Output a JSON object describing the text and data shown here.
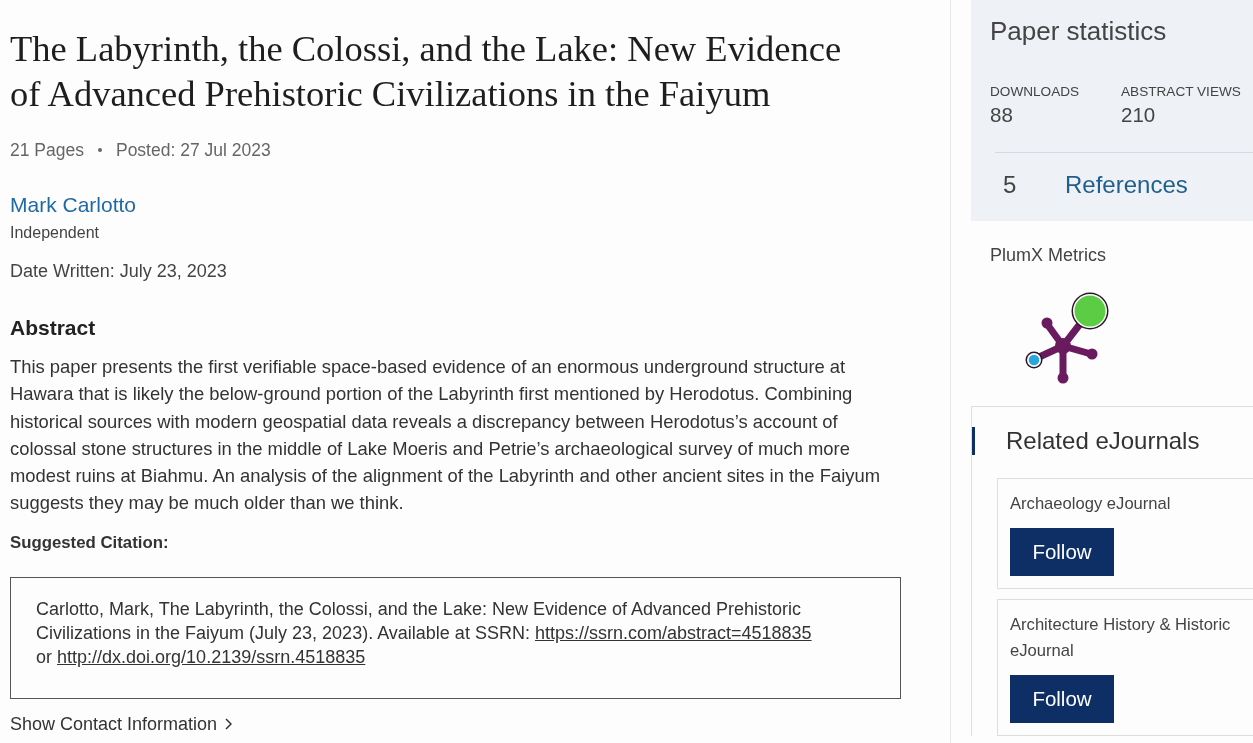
{
  "paper": {
    "title": "The Labyrinth, the Colossi, and the Lake: New Evidence of Advanced Prehistoric Civilizations in the Faiyum",
    "meta": [
      "21 Pages",
      "Posted: 27 Jul 2023"
    ],
    "authors": [
      {
        "name": "Mark Carlotto",
        "affiliation": "Independent"
      }
    ],
    "date_written": "Date Written: July 23, 2023",
    "abstract": {
      "heading": "Abstract",
      "text": "This paper presents the first verifiable space-based evidence of an enormous underground structure at Hawara that is likely the below-ground portion of the Labyrinth first mentioned by Herodotus. Combining historical sources with modern geospatial data reveals a discrepancy between Herodotus’s account of colossal stone structures in the middle of Lake Moeris and Petrie’s archaeological survey of much more modest ruins at Biahmu. An analysis of the alignment of the Labyrinth and other ancient sites in the Faiyum suggests they may be much older than we think."
    },
    "citation": {
      "heading": "Suggested Citation:",
      "parts": [
        {
          "kind": "text",
          "text": "Carlotto, Mark, The Labyrinth, the Colossi, and the Lake: New Evidence of Advanced Prehistoric Civilizations in the Faiyum (July 23, 2023). Available at SSRN:"
        },
        {
          "kind": "link",
          "text": "https://ssrn.com/abstract=4518835"
        },
        {
          "kind": "line_break"
        },
        {
          "kind": "text",
          "text": "or"
        },
        {
          "kind": "link",
          "text": "http://dx.doi.org/10.2139/ssrn.4518835"
        }
      ]
    },
    "contact_link": "Show Contact Information"
  },
  "sidebar": {
    "statistics": {
      "title": "Paper statistics",
      "stats": [
        {
          "label": "DOWNLOADS",
          "value": "88"
        },
        {
          "label": "ABSTRACT VIEWS",
          "value": "210"
        }
      ],
      "references": {
        "count": "5",
        "label": "References"
      }
    },
    "plumx": {
      "title": "PlumX Metrics"
    },
    "related": {
      "title": "Related eJournals",
      "journals": [
        {
          "name": "Archaeology eJournal",
          "button": "Follow"
        },
        {
          "name": "Architecture History & Historic\neJournal",
          "button": "Follow"
        }
      ]
    }
  }
}
